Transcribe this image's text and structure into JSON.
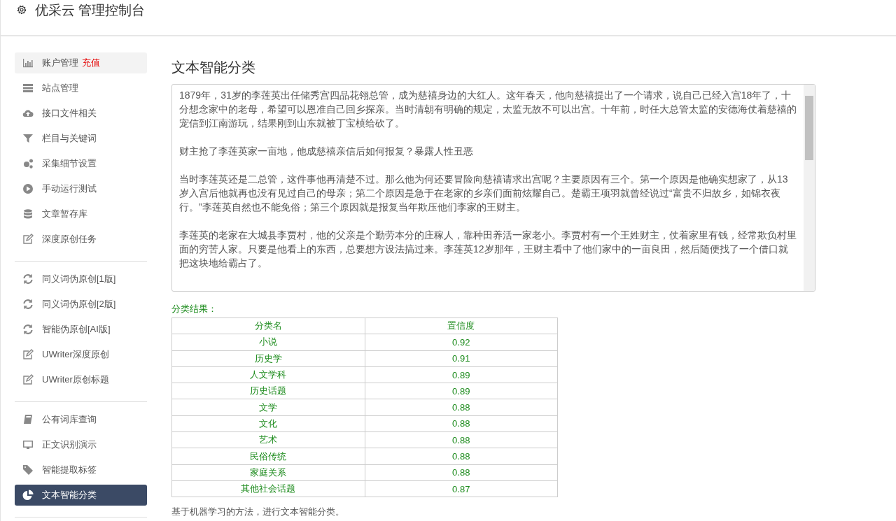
{
  "header": {
    "title": "优采云 管理控制台"
  },
  "sidebar": {
    "groups": [
      {
        "items": [
          {
            "kind": "chart",
            "label": "账户管理",
            "badge": "充值",
            "highlighted": true,
            "selected": false
          },
          {
            "kind": "server",
            "label": "站点管理",
            "highlighted": false,
            "selected": false
          },
          {
            "kind": "cloud",
            "label": "接口文件相关",
            "highlighted": false,
            "selected": false
          },
          {
            "kind": "filter",
            "label": "栏目与关键词",
            "highlighted": false,
            "selected": false
          },
          {
            "kind": "gears",
            "label": "采集细节设置",
            "highlighted": false,
            "selected": false
          },
          {
            "kind": "play",
            "label": "手动运行测试",
            "highlighted": false,
            "selected": false
          },
          {
            "kind": "database",
            "label": "文章暂存库",
            "highlighted": false,
            "selected": false
          },
          {
            "kind": "edit",
            "label": "深度原创任务",
            "highlighted": false,
            "selected": false
          }
        ]
      },
      {
        "items": [
          {
            "kind": "refresh",
            "label": "同义词伪原创[1版]",
            "highlighted": false,
            "selected": false
          },
          {
            "kind": "refresh",
            "label": "同义词伪原创[2版]",
            "highlighted": false,
            "selected": false
          },
          {
            "kind": "refresh",
            "label": "智能伪原创[AI版]",
            "highlighted": false,
            "selected": false
          },
          {
            "kind": "edit",
            "label": "UWriter深度原创",
            "highlighted": false,
            "selected": false
          },
          {
            "kind": "edit",
            "label": "UWriter原创标题",
            "highlighted": false,
            "selected": false
          }
        ]
      },
      {
        "items": [
          {
            "kind": "book",
            "label": "公有词库查询",
            "highlighted": false,
            "selected": false
          },
          {
            "kind": "monitor",
            "label": "正文识别演示",
            "highlighted": false,
            "selected": false
          },
          {
            "kind": "tag",
            "label": "智能提取标签",
            "highlighted": false,
            "selected": false
          },
          {
            "kind": "pie",
            "label": "文本智能分类",
            "highlighted": false,
            "selected": true
          }
        ]
      }
    ]
  },
  "main": {
    "title": "文本智能分类",
    "input_text": [
      "1879年，31岁的李莲英出任储秀宫四品花翎总管，成为慈禧身边的大红人。这年春天，他向慈禧提出了一个请求，说自己已经入宫18年了，十分想念家中的老母，希望可以恩准自己回乡探亲。当时清朝有明确的规定，太监无故不可以出宫。十年前，时任大总管太监的安德海仗着慈禧的宠信到江南游玩，结果刚到山东就被丁宝桢给砍了。",
      "财主抢了李莲英家一亩地，他成慈禧亲信后如何报复？暴露人性丑恶",
      "当时李莲英还是二总管，这件事他再清楚不过。那么他为何还要冒险向慈禧请求出宫呢？主要原因有三个。第一个原因是他确实想家了，从13岁入宫后他就再也没有见过自己的母亲；第二个原因是急于在老家的乡亲们面前炫耀自己。楚霸王项羽就曾经说过“富贵不归故乡，如锦衣夜行。”李莲英自然也不能免俗；第三个原因就是报复当年欺压他们李家的王财主。",
      "李莲英的老家在大城县李贾村，他的父亲是个勤劳本分的庄稼人，靠种田养活一家老小。李贾村有一个王姓财主，仗着家里有钱，经常欺负村里面的穷苦人家。只要是他看上的东西，总要想方设法搞过来。李莲英12岁那年，王财主看中了他们家中的一亩良田，然后随便找了一个借口就把这块地给霸占了。"
    ],
    "result_label": "分类结果：",
    "table": {
      "columns": [
        "分类名",
        "置信度"
      ],
      "rows": [
        [
          "小说",
          "0.92"
        ],
        [
          "历史学",
          "0.91"
        ],
        [
          "人文学科",
          "0.89"
        ],
        [
          "历史话题",
          "0.89"
        ],
        [
          "文学",
          "0.88"
        ],
        [
          "文化",
          "0.88"
        ],
        [
          "艺术",
          "0.88"
        ],
        [
          "民俗传统",
          "0.88"
        ],
        [
          "家庭关系",
          "0.88"
        ],
        [
          "其他社会话题",
          "0.87"
        ]
      ]
    },
    "note": "基于机器学习的方法，进行文本智能分类。"
  }
}
